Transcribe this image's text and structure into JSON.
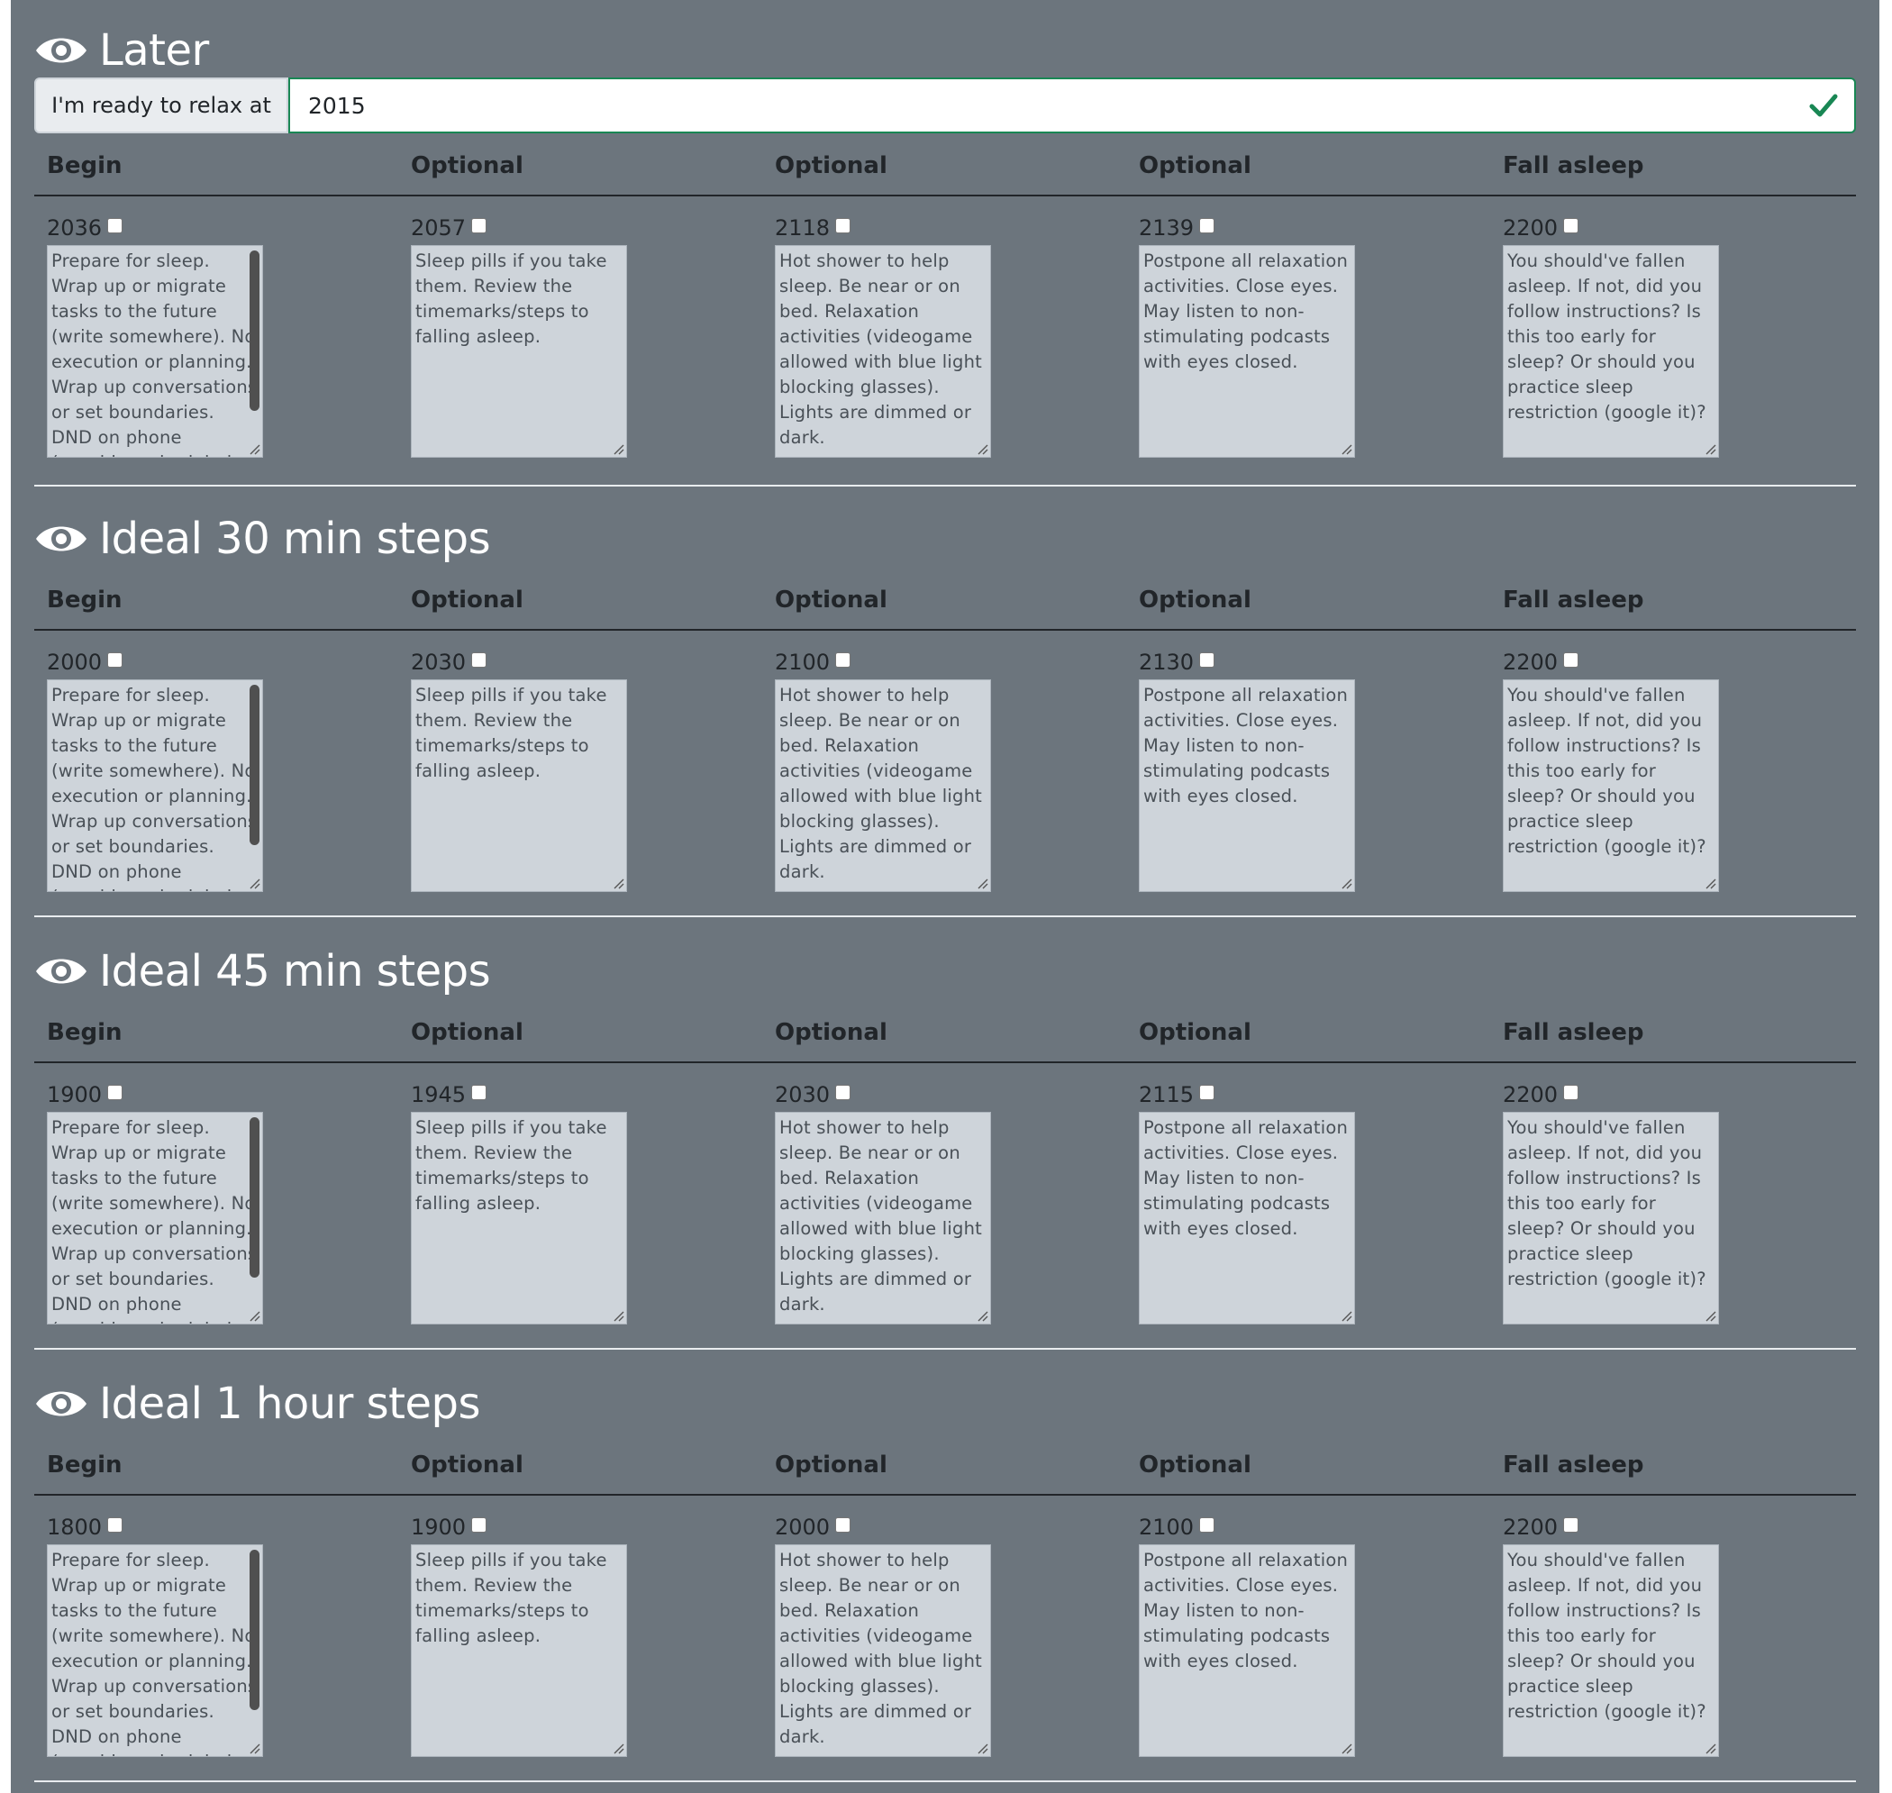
{
  "relax": {
    "prefix": "I'm ready to relax at",
    "value": "2015"
  },
  "columns": [
    "Begin",
    "Optional",
    "Optional",
    "Optional",
    "Fall asleep"
  ],
  "notes": [
    "Prepare for sleep. Wrap up or migrate tasks to the future (write somewhere). No execution or planning. Wrap up conversations or set boundaries. DND on phone (consider scheduled DND).",
    "Sleep pills if you take them. Review the timemarks/steps to falling asleep.",
    "Hot shower to help sleep. Be near or on bed. Relaxation activities (videogame allowed with blue light blocking glasses). Lights are dimmed or dark.",
    "Postpone all relaxation activities. Close eyes. May listen to non-stimulating podcasts with eyes closed.",
    "You should've fallen asleep. If not, did you follow instructions? Is this too early for sleep? Or should you practice sleep restriction (google it)?"
  ],
  "sections": [
    {
      "title": "Later",
      "times": [
        "2036",
        "2057",
        "2118",
        "2139",
        "2200"
      ]
    },
    {
      "title": "Ideal 30 min steps",
      "times": [
        "2000",
        "2030",
        "2100",
        "2130",
        "2200"
      ]
    },
    {
      "title": "Ideal 45 min steps",
      "times": [
        "1900",
        "1945",
        "2030",
        "2115",
        "2200"
      ]
    },
    {
      "title": "Ideal 1 hour steps",
      "times": [
        "1800",
        "1900",
        "2000",
        "2100",
        "2200"
      ]
    }
  ],
  "icons": {
    "section": "eye-icon",
    "valid": "check-icon",
    "resize": "resize-grip-icon"
  },
  "colors": {
    "panel": "#6c757d",
    "valid": "#198754",
    "textarea": "#ced4da"
  }
}
